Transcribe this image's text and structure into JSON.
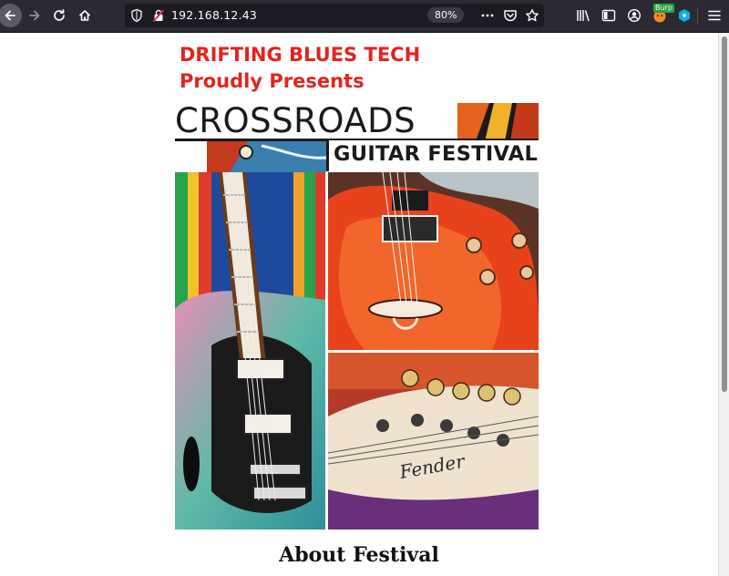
{
  "browser": {
    "url": "192.168.12.43",
    "zoom": "80%",
    "extension_badge": "Burp"
  },
  "poster": {
    "presenter_line1": "DRIFTING BLUES TECH",
    "presenter_line2": "Proudly Presents",
    "title": "CROSSROADS",
    "subtitle": "GUITAR FESTIVAL"
  },
  "page": {
    "heading": "About Festival"
  },
  "colors": {
    "toolbar": "#2b2a33",
    "urlbar": "#1c1b22",
    "presenter_red": "#e4231e",
    "guitar_red": "#e8421c"
  },
  "icons": [
    "back-arrow-icon",
    "forward-arrow-icon",
    "reload-icon",
    "home-icon",
    "shield-icon",
    "insecure-lock-icon",
    "more-icon",
    "pocket-icon",
    "bookmark-star-icon",
    "library-icon",
    "sidebar-icon",
    "account-icon",
    "burp-icon",
    "extension-icon",
    "menu-icon"
  ]
}
